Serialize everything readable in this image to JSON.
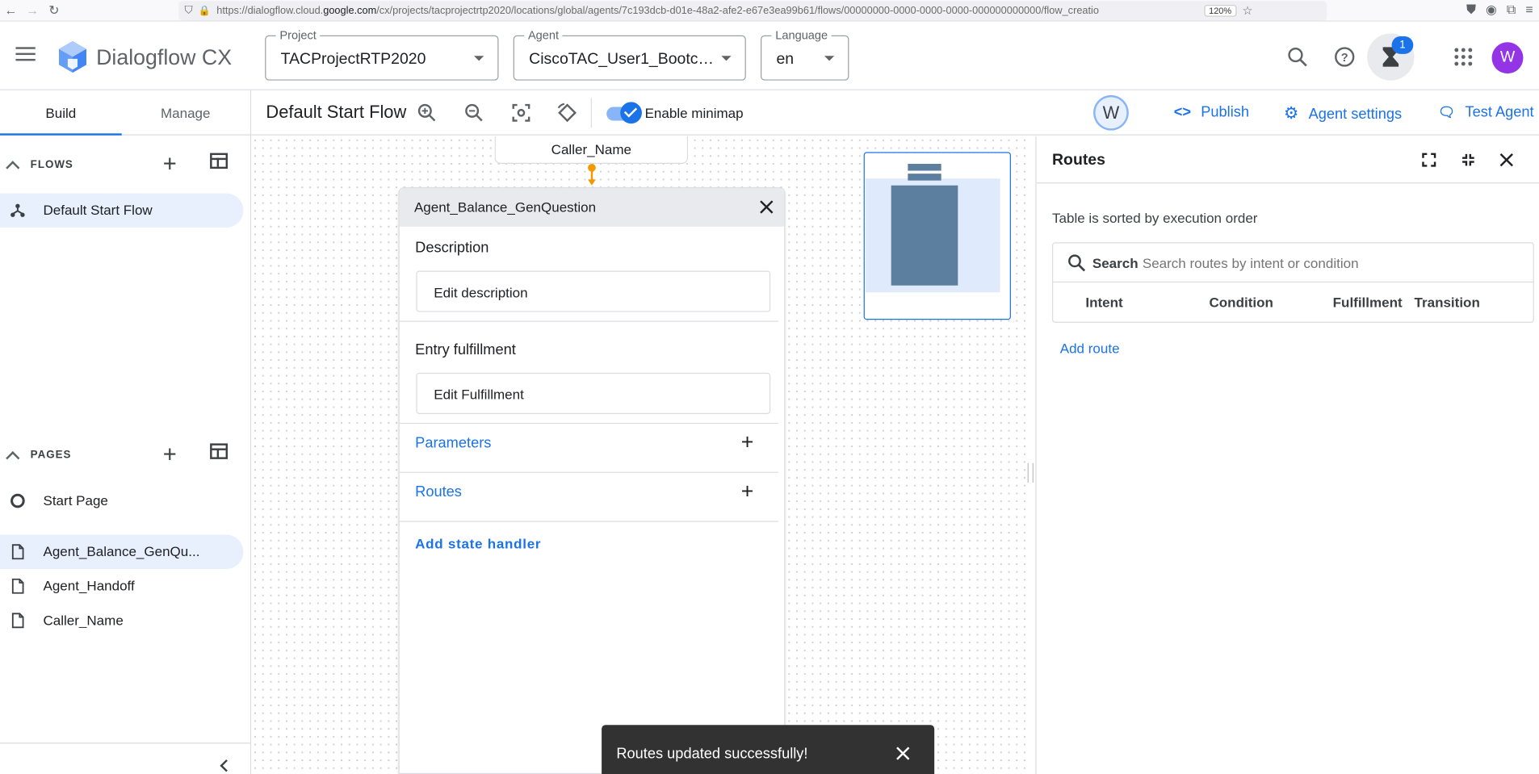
{
  "browser": {
    "url_prefix": "https://dialogflow.cloud.",
    "url_domain": "google.com",
    "url_suffix": "/cx/projects/tacprojectrtp2020/locations/global/agents/7c193dcb-d01e-48a2-afe2-e67e3ea99b61/flows/00000000-0000-0000-0000-000000000000/flow_creatio",
    "zoom": "120%"
  },
  "app": {
    "title": "Dialogflow CX",
    "project": {
      "label": "Project",
      "value": "TACProjectRTP2020"
    },
    "agent": {
      "label": "Agent",
      "value": "CiscoTAC_User1_Bootca..."
    },
    "language": {
      "label": "Language",
      "value": "en"
    },
    "notification_count": "1",
    "user_initial": "W"
  },
  "sidebar": {
    "tabs": [
      "Build",
      "Manage"
    ],
    "flows_title": "FLOWS",
    "flows": [
      {
        "label": "Default Start Flow"
      }
    ],
    "pages_title": "PAGES",
    "pages": [
      {
        "label": "Start Page"
      },
      {
        "label": "Agent_Balance_GenQu..."
      },
      {
        "label": "Agent_Handoff"
      },
      {
        "label": "Caller_Name"
      }
    ]
  },
  "toolbar": {
    "flow_title": "Default Start Flow",
    "minimap_label": "Enable minimap",
    "collaborator_initial": "W",
    "publish": "Publish",
    "agent_settings": "Agent settings",
    "test_agent": "Test Agent"
  },
  "canvas": {
    "caller_node": "Caller_Name",
    "page_panel": {
      "title": "Agent_Balance_GenQuestion",
      "description_title": "Description",
      "description_placeholder": "Edit description",
      "entry_title": "Entry fulfillment",
      "entry_placeholder": "Edit Fulfillment",
      "parameters": "Parameters",
      "routes": "Routes",
      "add_state_handler": "Add state handler"
    }
  },
  "routes_panel": {
    "title": "Routes",
    "sort_note": "Table is sorted by execution order",
    "search_label": "Search",
    "search_placeholder": "Search routes by intent or condition",
    "columns": [
      "Intent",
      "Condition",
      "Fulfillment",
      "Transition"
    ],
    "add_route": "Add route"
  },
  "snackbar": {
    "message": "Routes updated successfully!"
  },
  "colors": {
    "accent": "#1a73e8",
    "selected_bg": "#e8f0fe",
    "connector": "#f29900",
    "avatar": "#9334e6"
  }
}
